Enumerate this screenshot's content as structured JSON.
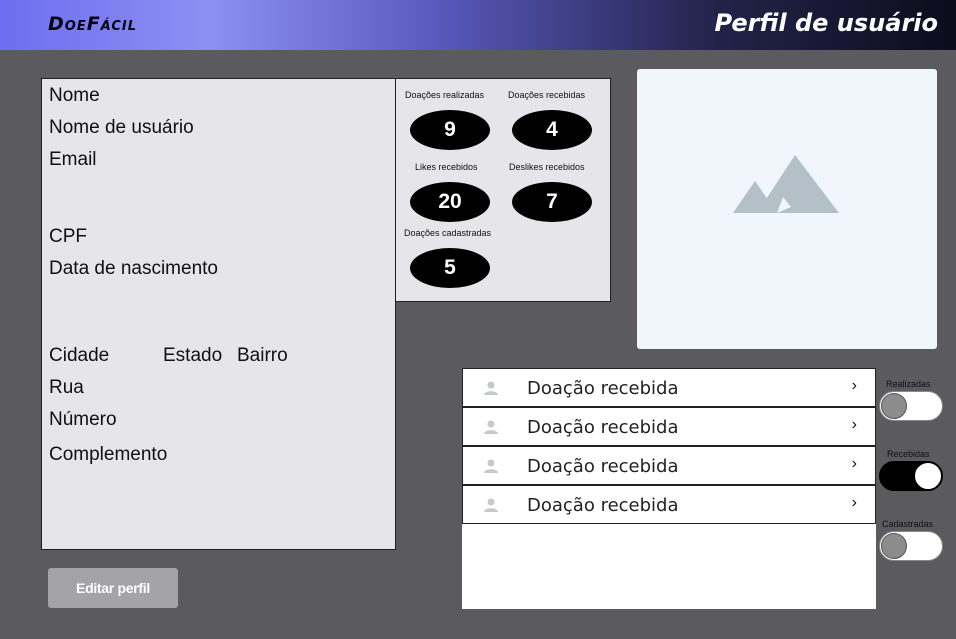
{
  "header": {
    "logo": "DoeFácil",
    "title": "Perfil de usuário"
  },
  "profile": {
    "fields": {
      "nome": "Nome",
      "usuario": "Nome de usuário",
      "email": "Email",
      "cpf": "CPF",
      "nascimento": "Data de nascimento",
      "cidade": "Cidade",
      "estado": "Estado",
      "bairro": "Bairro",
      "rua": "Rua",
      "numero": "Número",
      "complemento": "Complemento"
    },
    "edit_label": "Editar perfil"
  },
  "stats": {
    "realizadas": {
      "label": "Doações realizadas",
      "value": "9"
    },
    "recebidas": {
      "label": "Doações recebidas",
      "value": "4"
    },
    "likes": {
      "label": "Likes recebidos",
      "value": "20"
    },
    "deslikes": {
      "label": "Deslikes recebidos",
      "value": "7"
    },
    "cadastradas": {
      "label": "Doações cadastradas",
      "value": "5"
    }
  },
  "photo": {
    "icon": "image-placeholder-icon",
    "icon_color": "#b3c0c8"
  },
  "list": {
    "items": [
      {
        "label": "Doação recebida",
        "icon": "person-icon"
      },
      {
        "label": "Doação recebida",
        "icon": "person-icon"
      },
      {
        "label": "Doação recebida",
        "icon": "person-icon"
      },
      {
        "label": "Doação recebida",
        "icon": "person-icon"
      }
    ],
    "chevron": "›"
  },
  "toggles": {
    "realizadas": {
      "label": "Realizadas",
      "on": false
    },
    "recebidas": {
      "label": "Recebidas",
      "on": true
    },
    "cadastradas": {
      "label": "Cadastradas",
      "on": false
    }
  },
  "colors": {
    "background": "#5b5a5f",
    "panel": "#e6e6ea",
    "oval": "#000000",
    "button": "#a3a3a8"
  }
}
